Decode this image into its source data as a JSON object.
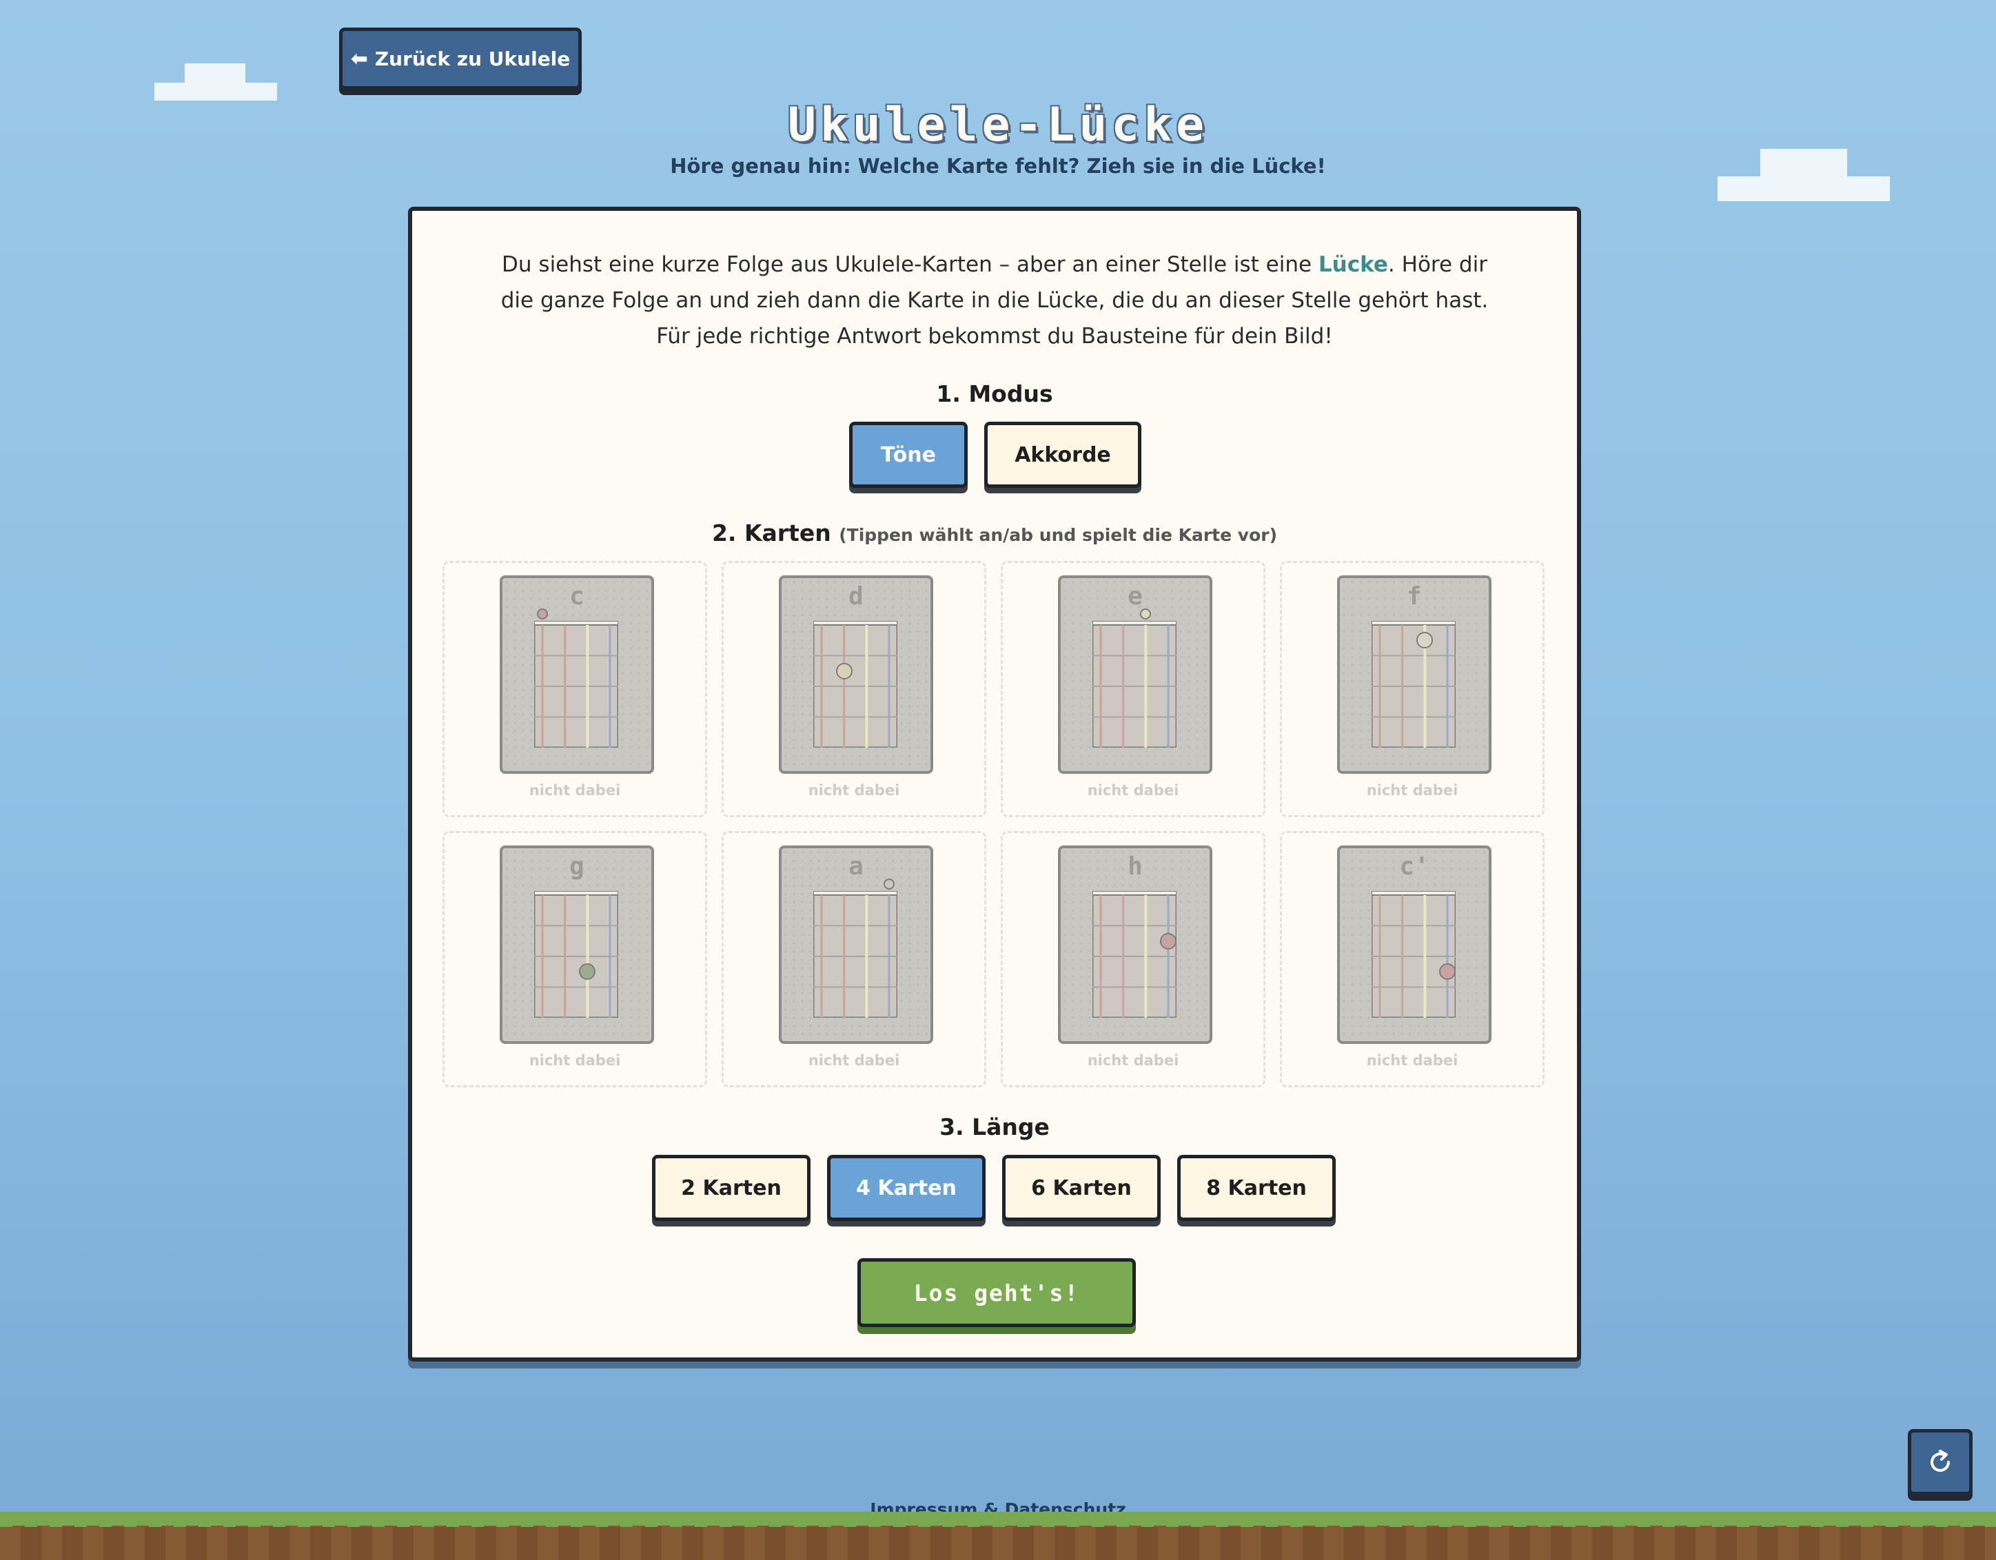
{
  "header": {
    "back_label": "Zurück zu Ukulele",
    "title": "Ukulele-Lücke",
    "subtitle": "Höre genau hin: Welche Karte fehlt? Zieh sie in die Lücke!"
  },
  "intro": {
    "before": "Du siehst eine kurze Folge aus Ukulele-Karten – aber an einer Stelle ist eine ",
    "highlight": "Lücke",
    "after": ". Höre dir die ganze Folge an und zieh dann die Karte in die Lücke, die du an dieser Stelle gehört hast. Für jede richtige Antwort bekommst du Bausteine für dein Bild!"
  },
  "mode": {
    "heading": "1. Modus",
    "options": [
      "Töne",
      "Akkorde"
    ],
    "selected": "Töne"
  },
  "cards_section": {
    "heading": "2. Karten",
    "hint": "(Tippen wählt an/ab und spielt die Karte vor)",
    "cards": [
      {
        "label": "c",
        "status": "nicht dabei",
        "dot": {
          "string": 1,
          "fret": 0,
          "color": "#c9a3a0"
        }
      },
      {
        "label": "d",
        "status": "nicht dabei",
        "dot": {
          "string": 2,
          "fret": 2,
          "color": "#d8d2b8"
        }
      },
      {
        "label": "e",
        "status": "nicht dabei",
        "dot": {
          "string": 3,
          "fret": 0,
          "color": "#dcd9c2"
        }
      },
      {
        "label": "f",
        "status": "nicht dabei",
        "dot": {
          "string": 3,
          "fret": 1,
          "color": "#d8d6c4"
        }
      },
      {
        "label": "g",
        "status": "nicht dabei",
        "dot": {
          "string": 3,
          "fret": 3,
          "color": "#9cab92"
        }
      },
      {
        "label": "a",
        "status": "nicht dabei",
        "dot": {
          "string": 4,
          "fret": 0,
          "color": "#c9c7c2"
        }
      },
      {
        "label": "h",
        "status": "nicht dabei",
        "dot": {
          "string": 4,
          "fret": 2,
          "color": "#c9a3a3"
        }
      },
      {
        "label": "c'",
        "status": "nicht dabei",
        "dot": {
          "string": 4,
          "fret": 3,
          "color": "#c9a3a3"
        }
      }
    ]
  },
  "length": {
    "heading": "3. Länge",
    "options": [
      "2 Karten",
      "4 Karten",
      "6 Karten",
      "8 Karten"
    ],
    "selected": "4 Karten"
  },
  "start_label": "Los geht's!",
  "footer": {
    "link": "Impressum & Datenschutz"
  },
  "icons": {
    "back": "arrow-left-icon",
    "reload": "reload-icon"
  },
  "colors": {
    "accent_blue": "#6aa3d8",
    "dark_blue": "#3f6592",
    "go_green": "#7aaa52",
    "highlight_teal": "#3f8a8c",
    "string_colors": [
      "#c9a3a0",
      "#c9a3a0",
      "#ece6c4",
      "#9aaac4"
    ]
  }
}
